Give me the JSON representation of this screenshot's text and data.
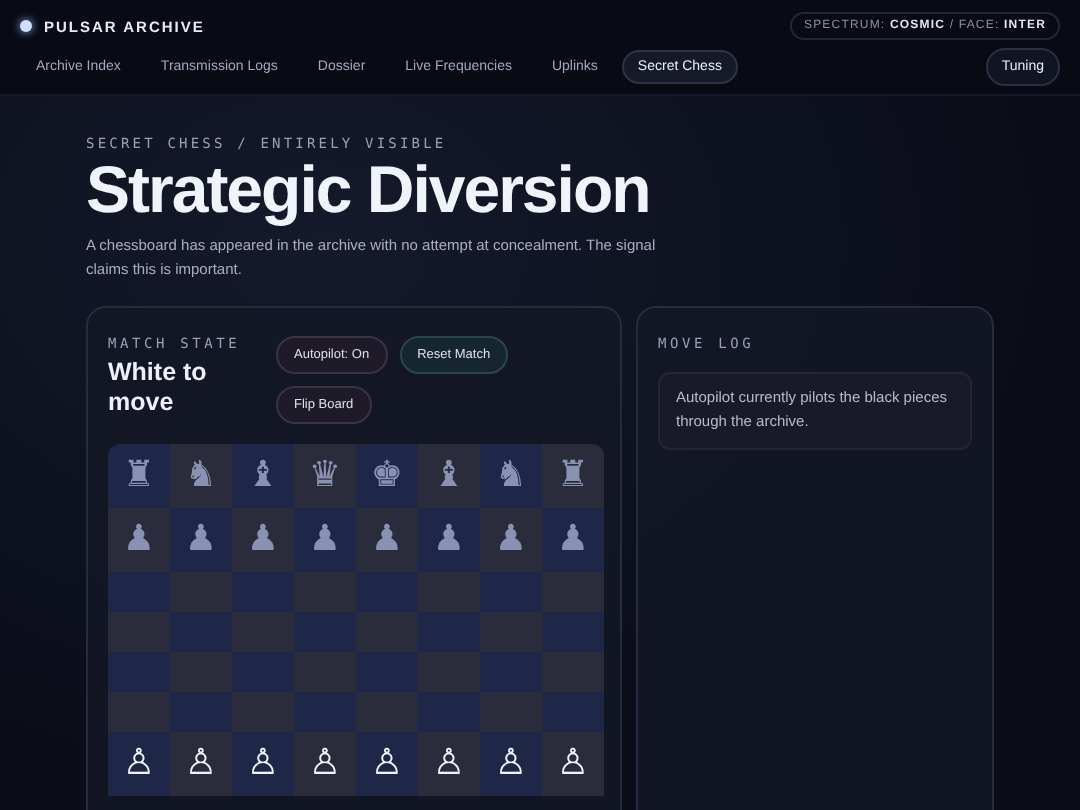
{
  "brand": {
    "name": "PULSAR ARCHIVE"
  },
  "badge": "SPECTRUM: **COSMIC** / FACE: **INTER**",
  "nav": [
    {
      "label": "Archive Index",
      "selected": false
    },
    {
      "label": "Transmission Logs",
      "selected": false
    },
    {
      "label": "Dossier",
      "selected": false
    },
    {
      "label": "Live Frequencies",
      "selected": false
    },
    {
      "label": "Uplinks",
      "selected": false
    },
    {
      "label": "Secret Chess",
      "selected": true
    }
  ],
  "tuning_button": "Tuning",
  "hero": {
    "kicker": "SECRET CHESS / ENTIRELY VISIBLE",
    "title": "Strategic Diversion",
    "description": "A chessboard has appeared in the archive with no attempt at concealment. The signal claims this is important."
  },
  "match": {
    "label": "MATCH STATE",
    "status": "White to move",
    "buttons": [
      {
        "label": "Autopilot: On",
        "kind": "toggle"
      },
      {
        "label": "Reset Match",
        "kind": "accent"
      },
      {
        "label": "Flip Board",
        "kind": "toggle"
      }
    ]
  },
  "board": [
    {
      "kind": "black",
      "pieces": [
        "♜",
        "♞",
        "♝",
        "♛",
        "♚",
        "♝",
        "♞",
        "♜"
      ]
    },
    {
      "kind": "black",
      "pieces": [
        "♟",
        "♟",
        "♟",
        "♟",
        "♟",
        "♟",
        "♟",
        "♟"
      ]
    },
    {
      "kind": "empty"
    },
    {
      "kind": "empty"
    },
    {
      "kind": "empty"
    },
    {
      "kind": "empty"
    },
    {
      "kind": "white",
      "pieces": [
        "♙",
        "♙",
        "♙",
        "♙",
        "♙",
        "♙",
        "♙",
        "♙"
      ]
    }
  ],
  "move_log": {
    "label": "MOVE LOG",
    "entries": [
      "Autopilot currently pilots the black pieces through the archive."
    ]
  }
}
